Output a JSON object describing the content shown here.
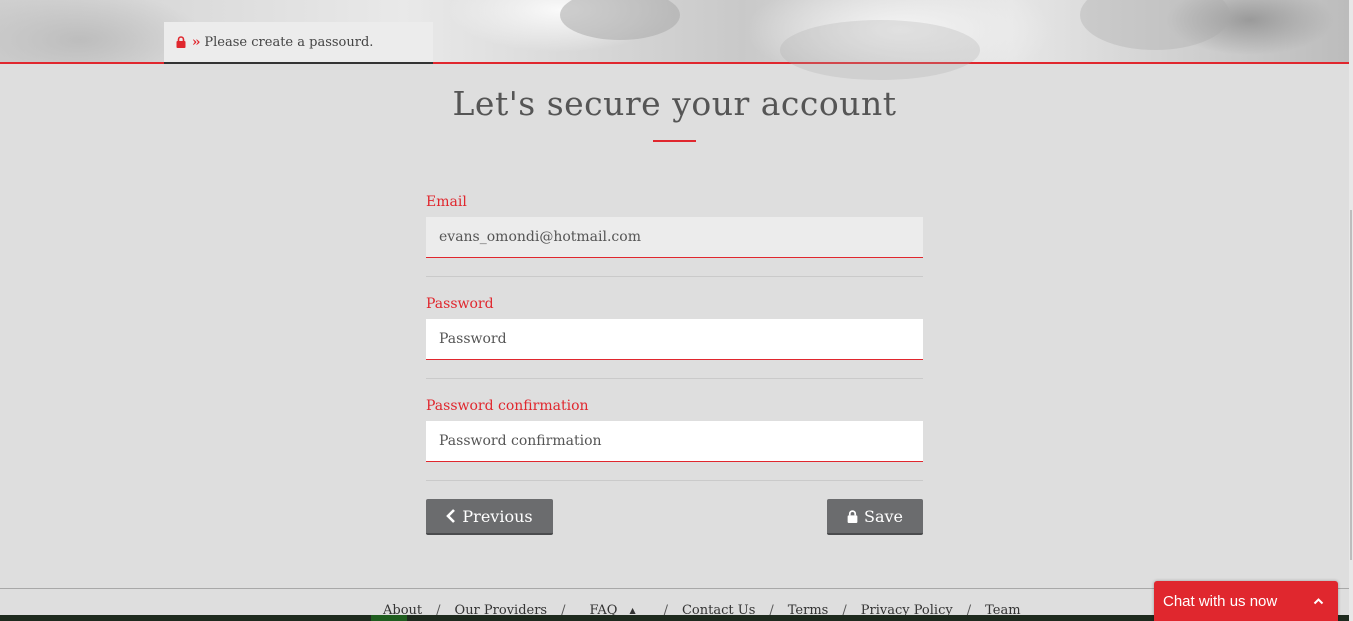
{
  "notice": {
    "text": "Please create a passourd."
  },
  "page": {
    "title": "Let's secure your account"
  },
  "form": {
    "email": {
      "label": "Email",
      "value": "evans_omondi@hotmail.com"
    },
    "password": {
      "label": "Password",
      "placeholder": "Password"
    },
    "password_confirmation": {
      "label": "Password confirmation",
      "placeholder": "Password confirmation"
    }
  },
  "buttons": {
    "previous": "Previous",
    "save": "Save"
  },
  "footer": {
    "links": [
      "About",
      "Our Providers",
      "FAQ",
      "Contact Us",
      "Terms",
      "Privacy Policy",
      "Team"
    ]
  },
  "chat": {
    "label": "Chat with us now"
  },
  "colors": {
    "accent": "#e0272e",
    "button": "#6b6c6e",
    "background": "#dedede"
  },
  "icons": {
    "notice": [
      "lock-icon",
      "double-chevron-right-icon"
    ],
    "previous": "chevron-left-icon",
    "save": "lock-icon",
    "chat": "chevron-up-icon"
  }
}
